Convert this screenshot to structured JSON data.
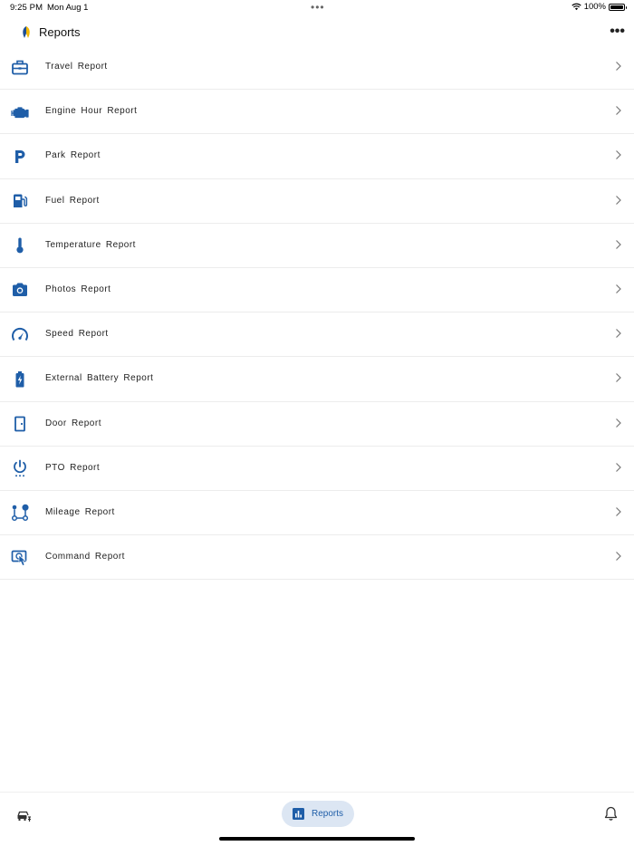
{
  "status": {
    "time": "9:25 PM",
    "date": "Mon Aug 1",
    "battery": "100%",
    "dots": "•••"
  },
  "header": {
    "title": "Reports",
    "more": "•••"
  },
  "accent_color": "#1f5ea8",
  "reports": [
    {
      "label": "Travel  Report",
      "icon": "briefcase-icon"
    },
    {
      "label": "Engine Hour  Report",
      "icon": "engine-icon"
    },
    {
      "label": "Park  Report",
      "icon": "parking-icon"
    },
    {
      "label": "Fuel  Report",
      "icon": "fuel-pump-icon"
    },
    {
      "label": "Temperature  Report",
      "icon": "thermometer-icon"
    },
    {
      "label": "Photos  Report",
      "icon": "camera-icon"
    },
    {
      "label": "Speed  Report",
      "icon": "speedometer-icon"
    },
    {
      "label": "External Battery  Report",
      "icon": "battery-charging-icon"
    },
    {
      "label": "Door  Report",
      "icon": "door-icon"
    },
    {
      "label": "PTO  Report",
      "icon": "power-icon"
    },
    {
      "label": "Mileage  Report",
      "icon": "route-icon"
    },
    {
      "label": "Command  Report",
      "icon": "command-touch-icon"
    }
  ],
  "bottom_nav": {
    "vehicles_icon": "vehicle-list-icon",
    "reports_label": "Reports",
    "reports_icon": "bar-chart-icon",
    "notifications_icon": "bell-icon"
  }
}
